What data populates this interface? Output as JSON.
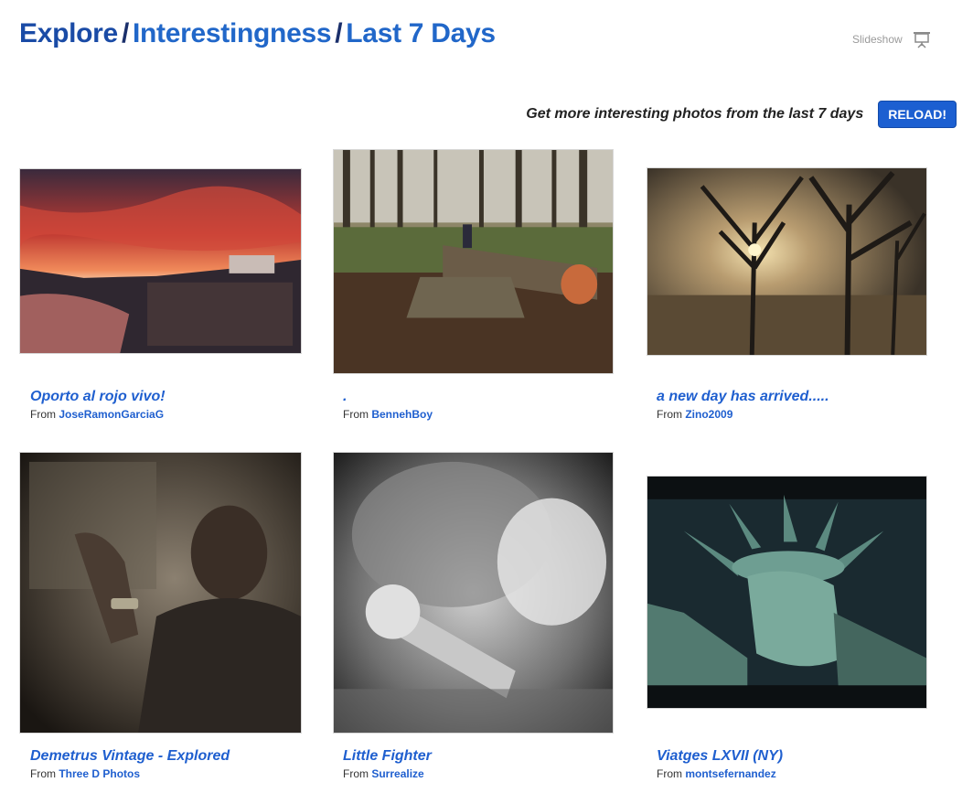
{
  "breadcrumb": {
    "root": "Explore",
    "section": "Interestingness",
    "period": "Last 7 Days",
    "separator": "/"
  },
  "slideshow": {
    "label": "Slideshow",
    "icon": "slideshow-screen-icon"
  },
  "reload": {
    "text": "Get more interesting photos from the last 7 days",
    "button_label": "RELOAD!"
  },
  "photos": [
    {
      "title": "Oporto al rojo vivo!",
      "from_label": "From",
      "author": "JoseRamonGarciaG"
    },
    {
      "title": ".",
      "from_label": "From",
      "author": "BennehBoy"
    },
    {
      "title": "a new day has arrived.....",
      "from_label": "From",
      "author": "Zino2009"
    },
    {
      "title": "Demetrus Vintage - Explored",
      "from_label": "From",
      "author": "Three D Photos"
    },
    {
      "title": "Little Fighter",
      "from_label": "From",
      "author": "Surrealize"
    },
    {
      "title": "Viatges LXVII (NY)",
      "from_label": "From",
      "author": "montsefernandez"
    }
  ],
  "colors": {
    "link": "#1f5fcf",
    "breadcrumb_root": "#1a4ba6",
    "button": "#1c5fd1"
  }
}
